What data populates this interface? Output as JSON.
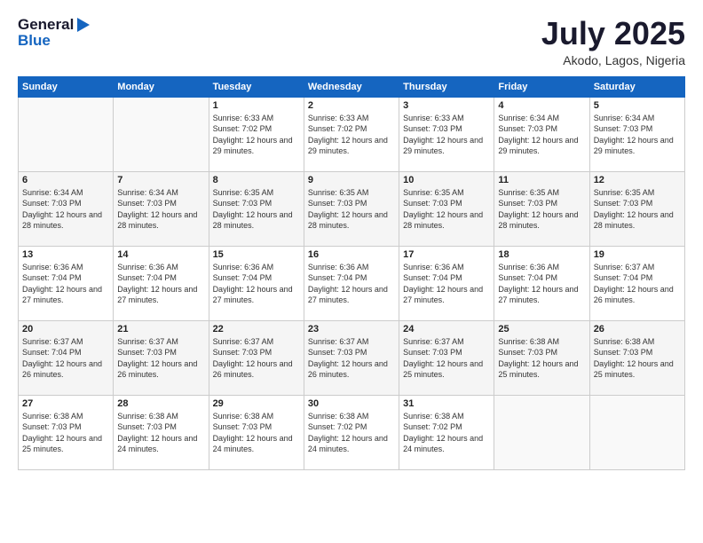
{
  "header": {
    "logo_general": "General",
    "logo_blue": "Blue",
    "month_year": "July 2025",
    "location": "Akodo, Lagos, Nigeria"
  },
  "days_of_week": [
    "Sunday",
    "Monday",
    "Tuesday",
    "Wednesday",
    "Thursday",
    "Friday",
    "Saturday"
  ],
  "weeks": [
    [
      {
        "day": "",
        "info": ""
      },
      {
        "day": "",
        "info": ""
      },
      {
        "day": "1",
        "info": "Sunrise: 6:33 AM\nSunset: 7:02 PM\nDaylight: 12 hours and 29 minutes."
      },
      {
        "day": "2",
        "info": "Sunrise: 6:33 AM\nSunset: 7:02 PM\nDaylight: 12 hours and 29 minutes."
      },
      {
        "day": "3",
        "info": "Sunrise: 6:33 AM\nSunset: 7:03 PM\nDaylight: 12 hours and 29 minutes."
      },
      {
        "day": "4",
        "info": "Sunrise: 6:34 AM\nSunset: 7:03 PM\nDaylight: 12 hours and 29 minutes."
      },
      {
        "day": "5",
        "info": "Sunrise: 6:34 AM\nSunset: 7:03 PM\nDaylight: 12 hours and 29 minutes."
      }
    ],
    [
      {
        "day": "6",
        "info": "Sunrise: 6:34 AM\nSunset: 7:03 PM\nDaylight: 12 hours and 28 minutes."
      },
      {
        "day": "7",
        "info": "Sunrise: 6:34 AM\nSunset: 7:03 PM\nDaylight: 12 hours and 28 minutes."
      },
      {
        "day": "8",
        "info": "Sunrise: 6:35 AM\nSunset: 7:03 PM\nDaylight: 12 hours and 28 minutes."
      },
      {
        "day": "9",
        "info": "Sunrise: 6:35 AM\nSunset: 7:03 PM\nDaylight: 12 hours and 28 minutes."
      },
      {
        "day": "10",
        "info": "Sunrise: 6:35 AM\nSunset: 7:03 PM\nDaylight: 12 hours and 28 minutes."
      },
      {
        "day": "11",
        "info": "Sunrise: 6:35 AM\nSunset: 7:03 PM\nDaylight: 12 hours and 28 minutes."
      },
      {
        "day": "12",
        "info": "Sunrise: 6:35 AM\nSunset: 7:03 PM\nDaylight: 12 hours and 28 minutes."
      }
    ],
    [
      {
        "day": "13",
        "info": "Sunrise: 6:36 AM\nSunset: 7:04 PM\nDaylight: 12 hours and 27 minutes."
      },
      {
        "day": "14",
        "info": "Sunrise: 6:36 AM\nSunset: 7:04 PM\nDaylight: 12 hours and 27 minutes."
      },
      {
        "day": "15",
        "info": "Sunrise: 6:36 AM\nSunset: 7:04 PM\nDaylight: 12 hours and 27 minutes."
      },
      {
        "day": "16",
        "info": "Sunrise: 6:36 AM\nSunset: 7:04 PM\nDaylight: 12 hours and 27 minutes."
      },
      {
        "day": "17",
        "info": "Sunrise: 6:36 AM\nSunset: 7:04 PM\nDaylight: 12 hours and 27 minutes."
      },
      {
        "day": "18",
        "info": "Sunrise: 6:36 AM\nSunset: 7:04 PM\nDaylight: 12 hours and 27 minutes."
      },
      {
        "day": "19",
        "info": "Sunrise: 6:37 AM\nSunset: 7:04 PM\nDaylight: 12 hours and 26 minutes."
      }
    ],
    [
      {
        "day": "20",
        "info": "Sunrise: 6:37 AM\nSunset: 7:04 PM\nDaylight: 12 hours and 26 minutes."
      },
      {
        "day": "21",
        "info": "Sunrise: 6:37 AM\nSunset: 7:03 PM\nDaylight: 12 hours and 26 minutes."
      },
      {
        "day": "22",
        "info": "Sunrise: 6:37 AM\nSunset: 7:03 PM\nDaylight: 12 hours and 26 minutes."
      },
      {
        "day": "23",
        "info": "Sunrise: 6:37 AM\nSunset: 7:03 PM\nDaylight: 12 hours and 26 minutes."
      },
      {
        "day": "24",
        "info": "Sunrise: 6:37 AM\nSunset: 7:03 PM\nDaylight: 12 hours and 25 minutes."
      },
      {
        "day": "25",
        "info": "Sunrise: 6:38 AM\nSunset: 7:03 PM\nDaylight: 12 hours and 25 minutes."
      },
      {
        "day": "26",
        "info": "Sunrise: 6:38 AM\nSunset: 7:03 PM\nDaylight: 12 hours and 25 minutes."
      }
    ],
    [
      {
        "day": "27",
        "info": "Sunrise: 6:38 AM\nSunset: 7:03 PM\nDaylight: 12 hours and 25 minutes."
      },
      {
        "day": "28",
        "info": "Sunrise: 6:38 AM\nSunset: 7:03 PM\nDaylight: 12 hours and 24 minutes."
      },
      {
        "day": "29",
        "info": "Sunrise: 6:38 AM\nSunset: 7:03 PM\nDaylight: 12 hours and 24 minutes."
      },
      {
        "day": "30",
        "info": "Sunrise: 6:38 AM\nSunset: 7:02 PM\nDaylight: 12 hours and 24 minutes."
      },
      {
        "day": "31",
        "info": "Sunrise: 6:38 AM\nSunset: 7:02 PM\nDaylight: 12 hours and 24 minutes."
      },
      {
        "day": "",
        "info": ""
      },
      {
        "day": "",
        "info": ""
      }
    ]
  ]
}
